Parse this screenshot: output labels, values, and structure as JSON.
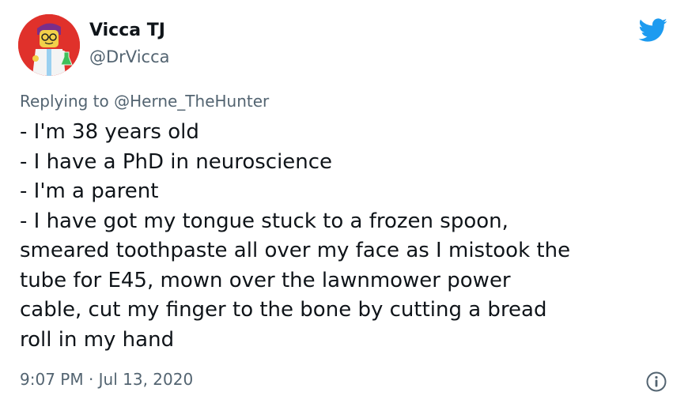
{
  "author": {
    "display_name": "Vicca TJ",
    "handle": "@DrVicca",
    "avatar_icon": "lego-scientist-avatar"
  },
  "reply": {
    "prefix": "Replying to",
    "handle": "@Herne_TheHunter",
    "text": "Replying to @Herne_TheHunter"
  },
  "tweet": {
    "lines": [
      "- I'm 38 years old",
      "- I have a PhD in neuroscience",
      "- I'm a parent",
      "- I have got my tongue stuck to a frozen spoon,",
      "smeared toothpaste all over my face as I mistook the",
      "tube for E45, mown over the lawnmower power",
      "cable, cut my finger to the bone by cutting a bread",
      "roll in my hand"
    ]
  },
  "meta": {
    "timestamp": "9:07 PM · Jul 13, 2020"
  },
  "icons": {
    "brand": "twitter-bird-icon",
    "info": "info-icon"
  },
  "colors": {
    "twitter_blue": "#1d9bf0",
    "text_primary": "#0f1419",
    "text_secondary": "#536471",
    "avatar_bg": "#e0312b"
  }
}
